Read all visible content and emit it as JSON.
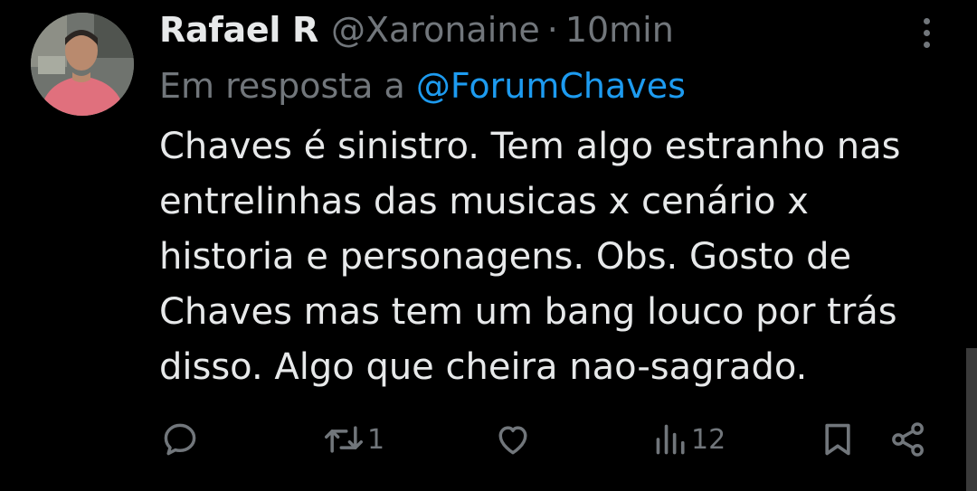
{
  "author": {
    "display_name": "Rafael R",
    "handle": "@Xaronaine",
    "separator": "·",
    "time": "10min"
  },
  "reply_context": {
    "prefix": "Em resposta a",
    "mention": "@ForumChaves"
  },
  "text_lines": [
    "Chaves é sinistro. Tem algo estranho nas",
    "entrelinhas das musicas x cenário x",
    "historia e personagens. Obs. Gosto de",
    "Chaves mas tem um bang louco por trás",
    "disso. Algo que cheira nao-sagrado."
  ],
  "actions": {
    "reply": {
      "icon": "reply-icon"
    },
    "retweet": {
      "icon": "retweet-icon",
      "count": "1"
    },
    "like": {
      "icon": "heart-icon"
    },
    "views": {
      "icon": "views-icon",
      "count": "12"
    },
    "bookmark": {
      "icon": "bookmark-icon"
    },
    "share": {
      "icon": "share-icon"
    }
  },
  "colors": {
    "background": "#000000",
    "text": "#e7e9ea",
    "muted": "#71767b",
    "accent": "#1d9bf0"
  }
}
